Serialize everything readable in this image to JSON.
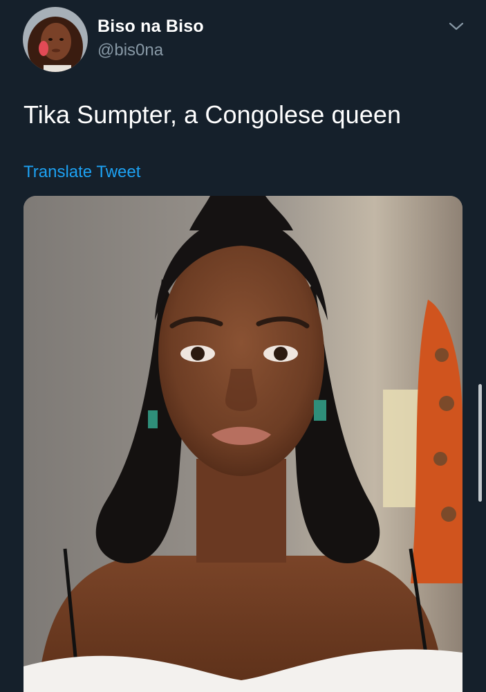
{
  "tweet": {
    "author": {
      "display_name": "Biso na Biso",
      "handle": "@bis0na",
      "avatar_icon": "user-avatar"
    },
    "text": "Tika Sumpter, a Congolese queen",
    "translate_label": "Translate Tweet",
    "menu_icon": "chevron-down-icon",
    "media_icon": "portrait-photo"
  },
  "colors": {
    "background": "#15202b",
    "primary_text": "#ffffff",
    "secondary_text": "#8899a6",
    "link": "#1da1f2"
  }
}
